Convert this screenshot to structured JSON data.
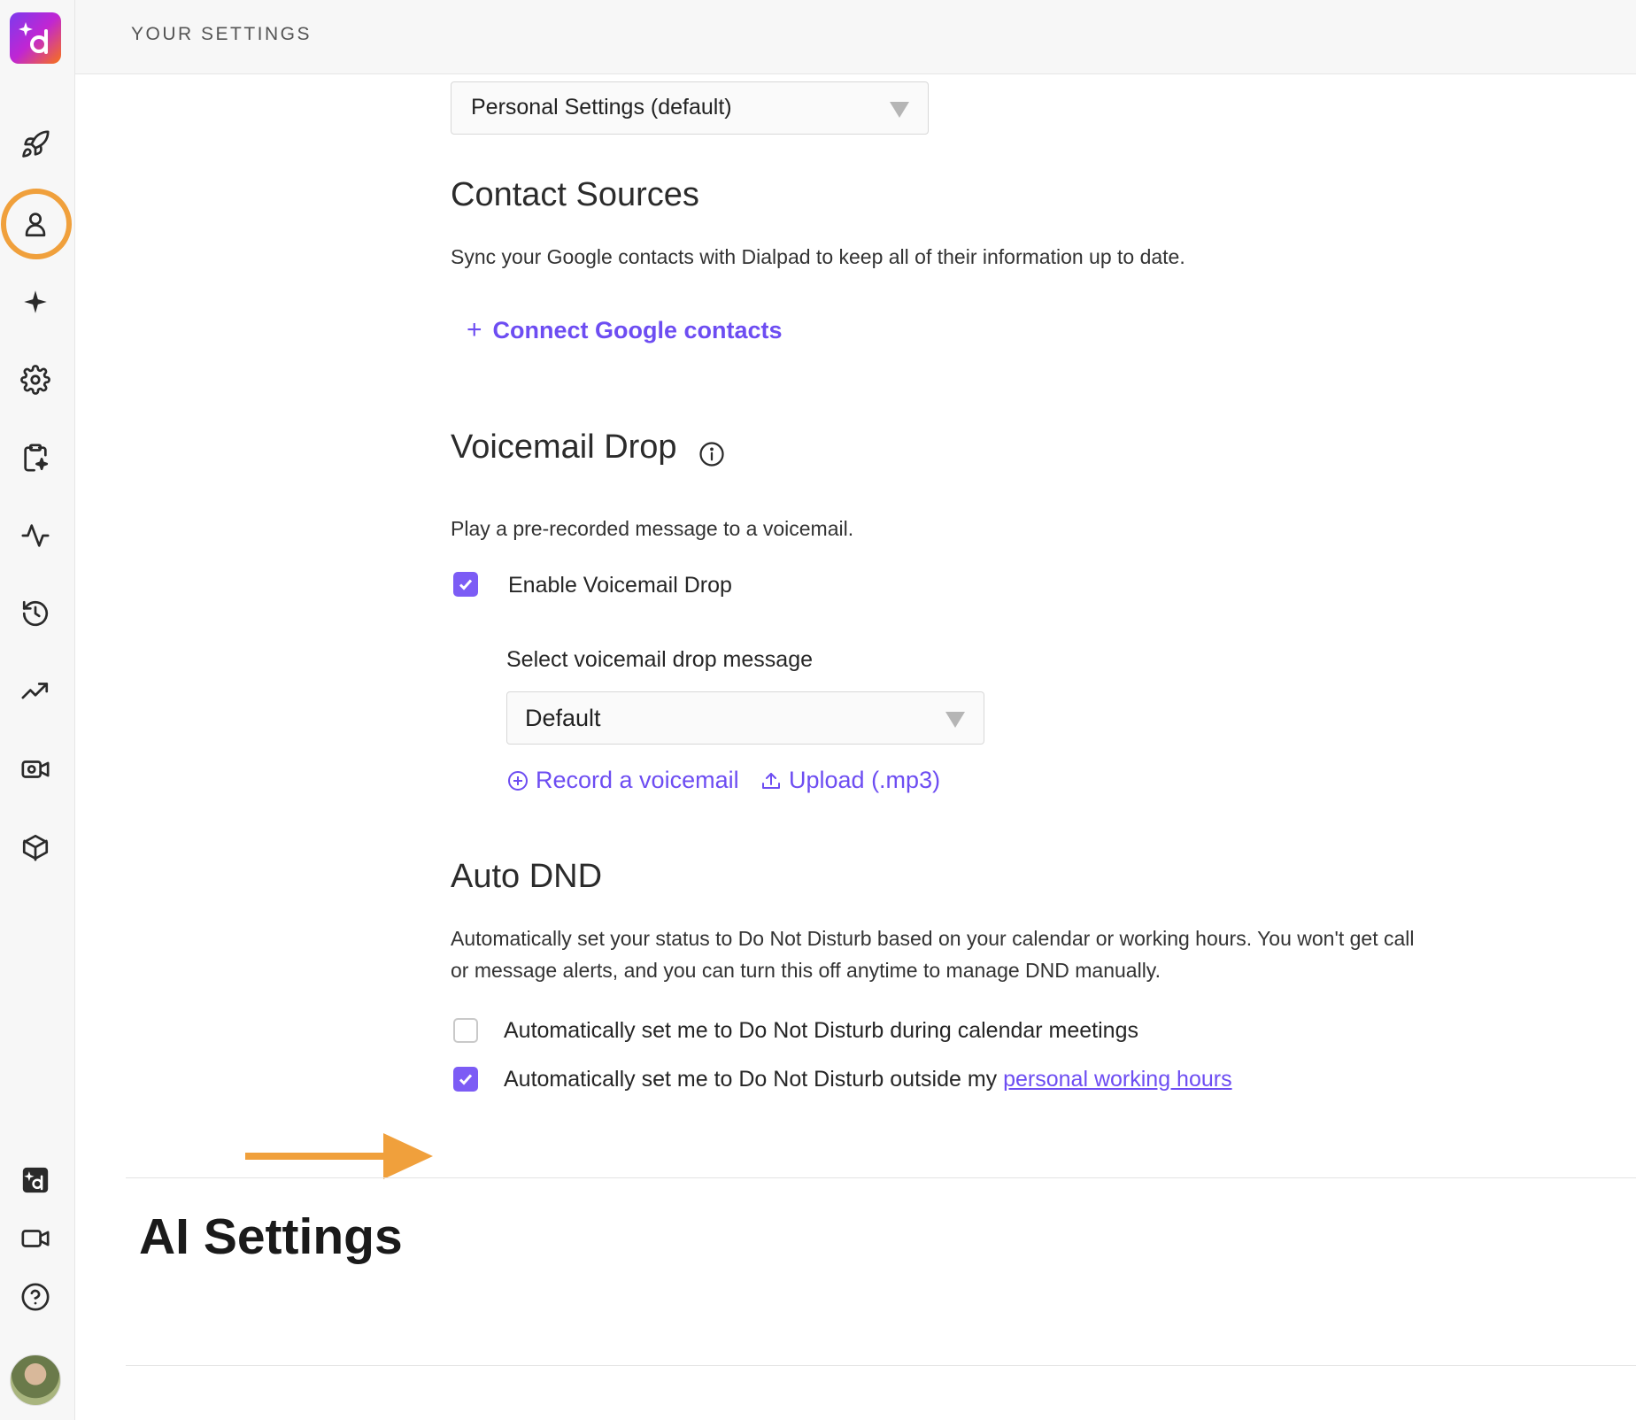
{
  "header": {
    "title": "YOUR SETTINGS"
  },
  "sidebar": {
    "logo_icon": "dialpad-logo-icon",
    "items": [
      {
        "icon": "rocket-icon"
      },
      {
        "icon": "person-icon",
        "active": true
      },
      {
        "icon": "sparkle-icon"
      },
      {
        "icon": "gear-icon"
      },
      {
        "icon": "clipboard-sparkle-icon"
      },
      {
        "icon": "activity-icon"
      },
      {
        "icon": "history-icon"
      },
      {
        "icon": "trending-icon"
      },
      {
        "icon": "video-gear-icon"
      },
      {
        "icon": "cube-icon"
      }
    ],
    "bottom_items": [
      {
        "icon": "dialpad-small-logo-icon"
      },
      {
        "icon": "video-camera-icon"
      },
      {
        "icon": "help-icon"
      },
      {
        "icon": "avatar"
      }
    ],
    "active_highlight_color": "#f0a03c"
  },
  "settings_profile": {
    "selected": "Personal Settings (default)"
  },
  "contact_sources": {
    "title": "Contact Sources",
    "description": "Sync your Google contacts with Dialpad to keep all of their information up to date.",
    "connect_label": "Connect Google contacts"
  },
  "voicemail_drop": {
    "title": "Voicemail Drop",
    "description": "Play a pre-recorded message to a voicemail.",
    "enable_label": "Enable Voicemail Drop",
    "enabled": true,
    "select_label": "Select voicemail drop message",
    "selected_message": "Default",
    "record_label": "Record a voicemail",
    "upload_label": "Upload (.mp3)"
  },
  "auto_dnd": {
    "title": "Auto DND",
    "description_line1": "Automatically set your status to Do Not Disturb based on your calendar or working hours. You won't get call",
    "description_line2": "or message alerts, and you can turn this off anytime to manage DND manually.",
    "calendar_label": "Automatically set me to Do Not Disturb during calendar meetings",
    "calendar_checked": false,
    "hours_label": "Automatically set me to Do Not Disturb outside my ",
    "hours_link": "personal working hours",
    "hours_checked": true
  },
  "ai_settings": {
    "title": "AI Settings"
  },
  "colors": {
    "accent": "#7c5cf5",
    "link": "#6d4df2",
    "annotation": "#f0a03c"
  }
}
